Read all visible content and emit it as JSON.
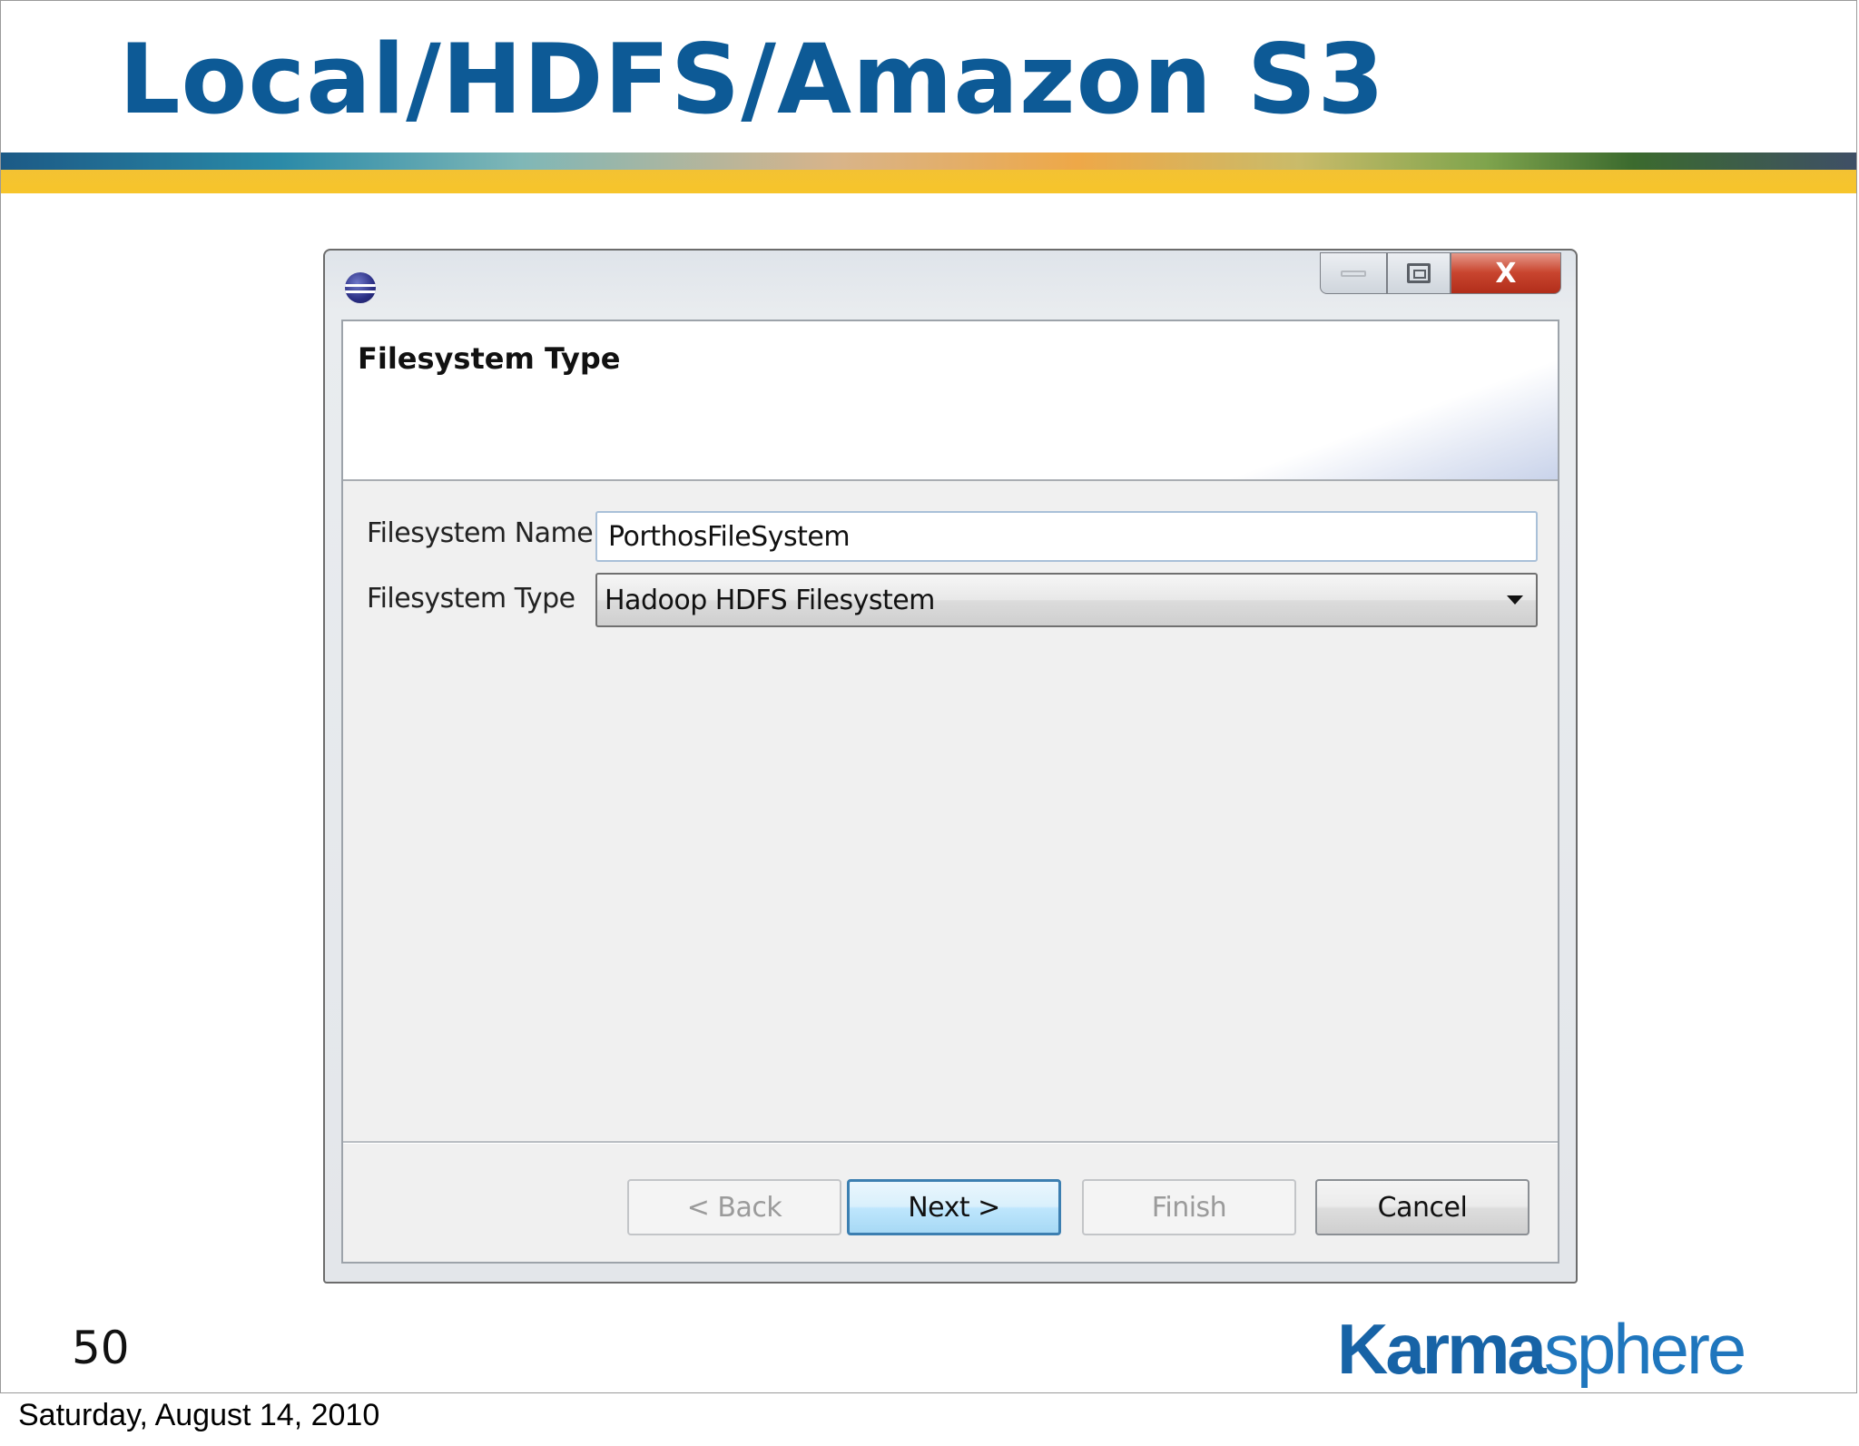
{
  "slide": {
    "title": "Local/HDFS/Amazon S3",
    "page_number": "50",
    "brand": {
      "part1": "Karma",
      "part2": "sphere"
    },
    "footer_date": "Saturday, August 14, 2010",
    "colors": {
      "title": "#0d5a96",
      "stripe_yellow": "#f7c52a",
      "brand_blue": "#1763a6"
    }
  },
  "dialog": {
    "header_title": "Filesystem Type",
    "fields": {
      "name_label": "Filesystem Name",
      "name_value": "PorthosFileSystem",
      "type_label": "Filesystem Type",
      "type_value": "Hadoop HDFS Filesystem"
    },
    "buttons": {
      "back": "< Back",
      "next": "Next >",
      "finish": "Finish",
      "cancel": "Cancel"
    },
    "window_controls": {
      "close_glyph": "X"
    },
    "icons": [
      "eclipse-app-icon",
      "minimize-icon",
      "maximize-icon",
      "close-icon",
      "chevron-down-icon"
    ]
  }
}
